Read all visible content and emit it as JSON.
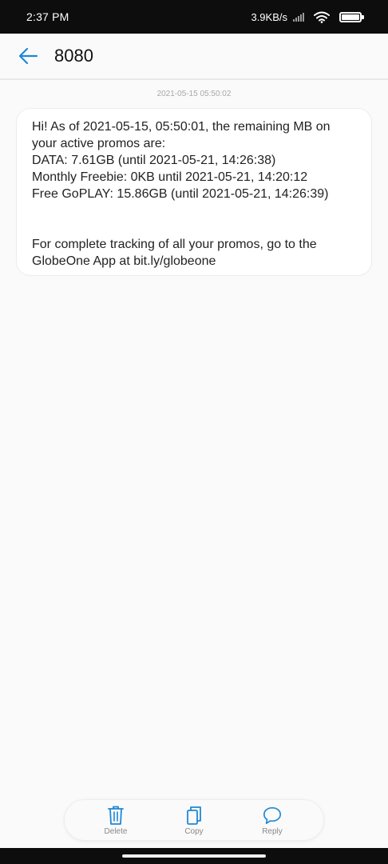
{
  "status_bar": {
    "time": "2:37 PM",
    "network_speed": "3.9KB/s",
    "icons": [
      "signal-icon",
      "wifi-icon",
      "battery-icon"
    ]
  },
  "header": {
    "back_icon": "arrow-left-icon",
    "title": "8080"
  },
  "thread": {
    "timestamp": "2021-05-15 05:50:02",
    "message": {
      "lines": [
        "Hi! As of 2021-05-15, 05:50:01, the remaining MB on",
        "your active promos are:",
        "DATA: 7.61GB (until 2021-05-21, 14:26:38)",
        "Monthly Freebie: 0KB until 2021-05-21, 14:20:12",
        "Free GoPLAY: 15.86GB (until 2021-05-21, 14:26:39)",
        "For complete tracking of all your promos, go to the",
        "GlobeOne App at bit.ly/globeone"
      ]
    }
  },
  "action_bar": {
    "items": [
      {
        "label": "Delete",
        "icon": "trash-icon"
      },
      {
        "label": "Copy",
        "icon": "copy-icon"
      },
      {
        "label": "Reply",
        "icon": "chat-bubble-icon"
      }
    ]
  },
  "colors": {
    "accent": "#1e88d6",
    "background": "#fafafa",
    "status_bar": "#0d0d0d",
    "bubble": "#ffffff"
  }
}
